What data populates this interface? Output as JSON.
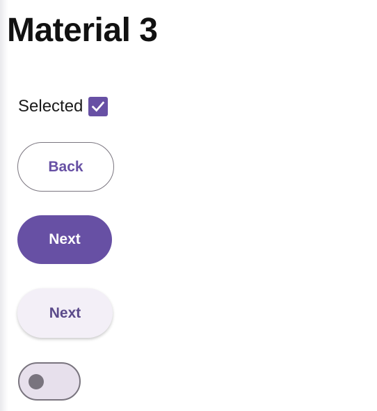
{
  "page": {
    "title": "Material 3"
  },
  "checkbox": {
    "label": "Selected",
    "checked": true
  },
  "buttons": {
    "outlined_label": "Back",
    "filled_label": "Next",
    "tonal_label": "Next"
  },
  "switch": {
    "on": false
  },
  "colors": {
    "primary": "#6750a4",
    "tonal_background": "#f3eff7",
    "outline": "#79747e",
    "switch_track": "#e7e0ec"
  },
  "icons": {
    "checkbox_mark": "check-icon"
  }
}
